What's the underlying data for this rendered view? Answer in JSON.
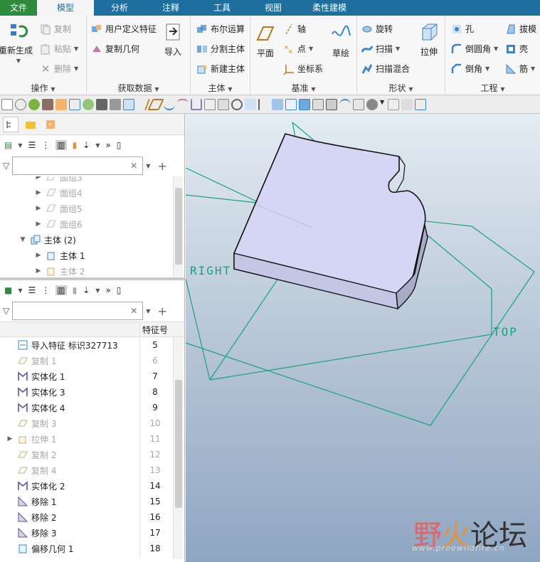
{
  "menu": {
    "tabs": [
      {
        "label": "文件"
      },
      {
        "label": "模型"
      },
      {
        "label": "分析"
      },
      {
        "label": "注释"
      },
      {
        "label": "工具"
      },
      {
        "label": "视图"
      },
      {
        "label": "柔性建模"
      }
    ]
  },
  "ribbon": {
    "operations": {
      "regen": "重新生成",
      "copy": "复制",
      "paste": "粘贴",
      "delete": "删除",
      "label": "操作"
    },
    "getdata": {
      "udf": "用户定义特征",
      "copygeom": "复制几何",
      "import": "导入",
      "label": "获取数据"
    },
    "body": {
      "boolean": "布尔运算",
      "split": "分割主体",
      "newbody": "新建主体",
      "label": "主体"
    },
    "datum": {
      "plane": "平面",
      "axis": "轴",
      "point": "点",
      "csys": "坐标系",
      "sketch": "草绘",
      "label": "基准"
    },
    "shape": {
      "revolve": "旋转",
      "sweep": "扫描",
      "blend": "扫描混合",
      "extrude": "拉伸",
      "label": "形状"
    },
    "engineering": {
      "hole": "孔",
      "round": "倒圆角",
      "chamfer": "倒角",
      "draft": "拔模",
      "shell": "壳",
      "rib": "筋",
      "label": "工程"
    }
  },
  "upper_tree": {
    "filter_placeholder": "",
    "rows": [
      {
        "label": "面组3",
        "dim": true
      },
      {
        "label": "面组4",
        "dim": true
      },
      {
        "label": "面组5",
        "dim": true
      },
      {
        "label": "面组6",
        "dim": true
      },
      {
        "label": "主体 (2)",
        "dim": false
      },
      {
        "label": "主体 1",
        "dim": false
      },
      {
        "label": "主体 2",
        "dim": true
      }
    ]
  },
  "lower_tree": {
    "filter_placeholder": "",
    "column_header": "特征号",
    "rows": [
      {
        "label": "导入特征 标识327713",
        "num": "5",
        "dim": false
      },
      {
        "label": "复制 1",
        "num": "6",
        "dim": true
      },
      {
        "label": "实体化 1",
        "num": "7",
        "dim": false
      },
      {
        "label": "实体化 3",
        "num": "8",
        "dim": false
      },
      {
        "label": "实体化 4",
        "num": "9",
        "dim": false
      },
      {
        "label": "复制 3",
        "num": "10",
        "dim": true
      },
      {
        "label": "拉伸 1",
        "num": "11",
        "dim": true
      },
      {
        "label": "复制 2",
        "num": "12",
        "dim": true
      },
      {
        "label": "复制 4",
        "num": "13",
        "dim": true
      },
      {
        "label": "实体化 2",
        "num": "14",
        "dim": false
      },
      {
        "label": "移除 1",
        "num": "15",
        "dim": false
      },
      {
        "label": "移除 2",
        "num": "16",
        "dim": false
      },
      {
        "label": "移除 3",
        "num": "17",
        "dim": false
      },
      {
        "label": "偏移几何 1",
        "num": "18",
        "dim": false
      }
    ]
  },
  "viewport": {
    "plane_right": "RIGHT",
    "plane_top": "TOP",
    "watermark_a": "野",
    "watermark_b": "火",
    "watermark_c": "论坛",
    "watermark_url": "www.proewildfire.cn"
  },
  "colors": {
    "accent": "#1f6f9e",
    "file_tab": "#2e8b3d",
    "datum_green": "#18a27e",
    "body_fill": "#d7daf5"
  }
}
